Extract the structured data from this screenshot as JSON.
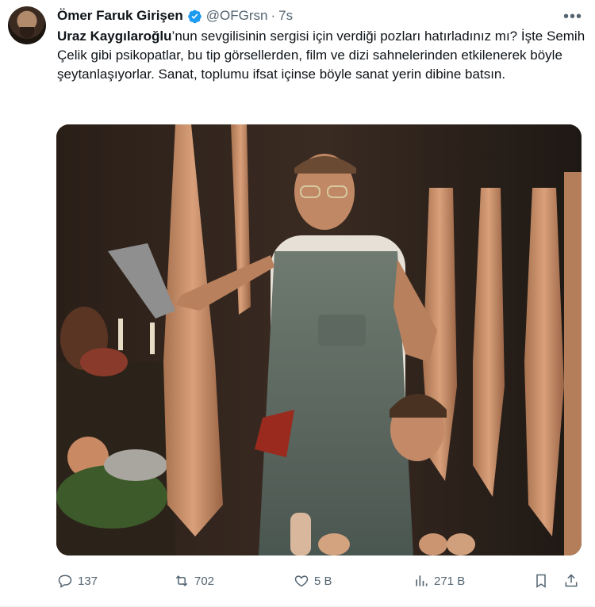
{
  "tweet": {
    "author_name": "Ömer Faruk Girişen",
    "handle": "@OFGrsn",
    "separator": "·",
    "time": "7s",
    "more_icon": "more-horizontal-icon",
    "mention": "Uraz Kaygılaroğlu",
    "text_rest": "’nun sevgilisinin sergisi için verdiği pozları hatırladınız mı? İşte Semih Çelik gibi psikopatlar, bu tip görsellerden, film ve dizi sahnelerinden etkilenerek böyle şeytanlaşıyorlar. Sanat, toplumu ifsat içinse böyle sanat yerin dibine batsın."
  },
  "actions": {
    "replies": "137",
    "reposts": "702",
    "likes": "5 B",
    "views": "271 B"
  },
  "colors": {
    "verified": "#1d9bf0",
    "secondary_text": "#536471",
    "primary_text": "#0f1419"
  }
}
